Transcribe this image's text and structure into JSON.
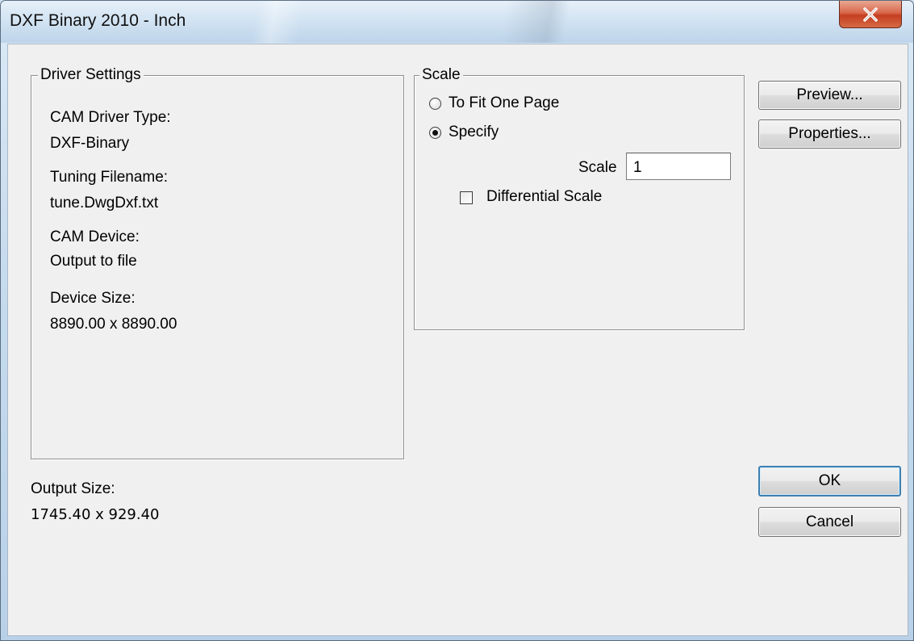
{
  "window": {
    "title": "DXF Binary 2010 - Inch",
    "close_glyph": "X"
  },
  "driver_settings": {
    "legend": "Driver Settings",
    "cam_driver_type_label": "CAM Driver Type:",
    "cam_driver_type_value": "DXF-Binary",
    "tuning_filename_label": "Tuning Filename:",
    "tuning_filename_value": "tune.DwgDxf.txt",
    "cam_device_label": "CAM Device:",
    "cam_device_value": "Output to file",
    "device_size_label": "Device Size:",
    "device_size_value": "8890.00 x 8890.00"
  },
  "scale": {
    "legend": "Scale",
    "option_fit_label": "To Fit One Page",
    "option_specify_label": "Specify",
    "selected_option": "specify",
    "scale_label": "Scale",
    "scale_value": "1",
    "differential_scale_label": "Differential Scale",
    "differential_scale_checked": false
  },
  "output": {
    "output_size_label": "Output Size:",
    "output_size_value": "1745.40 x 929.40"
  },
  "buttons": {
    "preview": "Preview...",
    "properties": "Properties...",
    "ok": "OK",
    "cancel": "Cancel"
  }
}
